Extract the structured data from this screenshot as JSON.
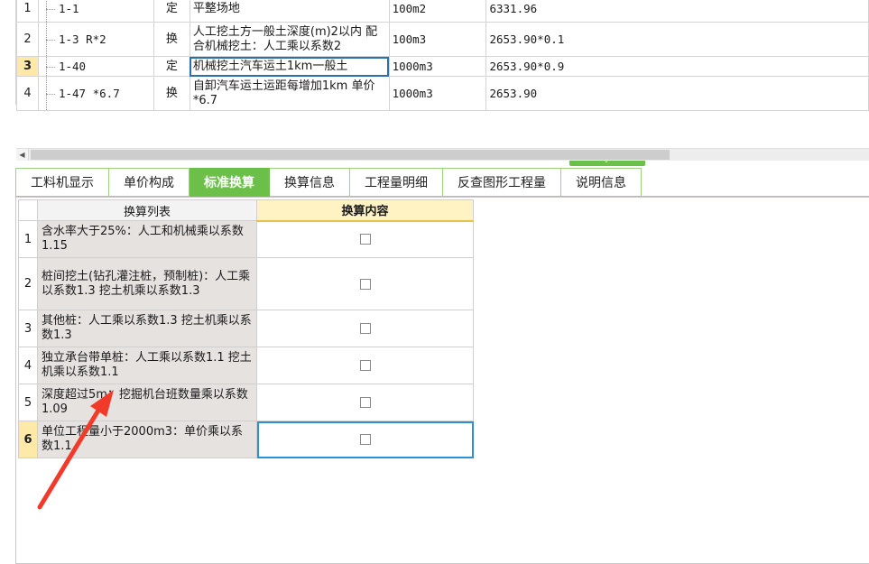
{
  "top_grid": {
    "rows": [
      {
        "num": "1",
        "code": "1-1",
        "type": "定",
        "name": "平整场地",
        "unit": "100m2",
        "qty": "6331.96",
        "selected": false
      },
      {
        "num": "2",
        "code": "1-3 R*2",
        "type": "换",
        "name": "人工挖土方一般土深度(m)2以内 配合机械挖土：人工乘以系数2",
        "unit": "100m3",
        "qty": "2653.90*0.1",
        "selected": false
      },
      {
        "num": "3",
        "code": "1-40",
        "type": "定",
        "name": "机械挖土汽车运土1km一般土",
        "unit": "1000m3",
        "qty": "2653.90*0.9",
        "selected": true
      },
      {
        "num": "4",
        "code": "1-47 *6.7",
        "type": "换",
        "name": "自卸汽车运土运距每增加1km 单价*6.7",
        "unit": "1000m3",
        "qty": "2653.90",
        "selected": false
      }
    ]
  },
  "tabs": [
    {
      "label": "工料机显示",
      "active": false
    },
    {
      "label": "单价构成",
      "active": false
    },
    {
      "label": "标准换算",
      "active": true
    },
    {
      "label": "换算信息",
      "active": false
    },
    {
      "label": "工程量明细",
      "active": false
    },
    {
      "label": "反查图形工程量",
      "active": false
    },
    {
      "label": "说明信息",
      "active": false
    }
  ],
  "conversion_table": {
    "headers": {
      "list": "换算列表",
      "content": "换算内容"
    },
    "rows": [
      {
        "num": "1",
        "desc": "含水率大于25%：人工和机械乘以系数1.15",
        "checked": false,
        "selected": false
      },
      {
        "num": "2",
        "desc": "桩间挖土(钻孔灌注桩，预制桩)：人工乘以系数1.3 挖土机乘以系数1.3",
        "checked": false,
        "selected": false
      },
      {
        "num": "3",
        "desc": "其他桩：人工乘以系数1.3 挖土机乘以系数1.3",
        "checked": false,
        "selected": false
      },
      {
        "num": "4",
        "desc": "独立承台带单桩：人工乘以系数1.1 挖土机乘以系数1.1",
        "checked": false,
        "selected": false
      },
      {
        "num": "5",
        "desc": "深度超过5m：挖掘机台班数量乘以系数1.09",
        "checked": false,
        "selected": false
      },
      {
        "num": "6",
        "desc": "单位工程量小于2000m3：单价乘以系数1.1",
        "checked": false,
        "selected": true
      }
    ]
  },
  "colors": {
    "tab_active": "#6cc04a",
    "selected_row": "#ffe9a8",
    "desc_bg": "#e6e2e0",
    "arrow": "#f23a2a"
  },
  "icons": {
    "scroll_left": "triangle-left-icon",
    "splitter": "chevron-down-icon",
    "checkbox": "checkbox-icon"
  }
}
